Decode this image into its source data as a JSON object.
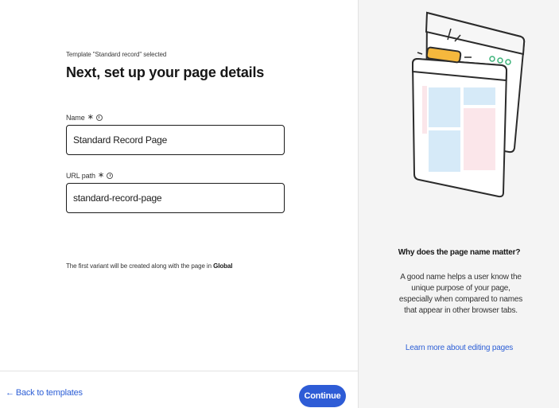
{
  "form": {
    "subtitle": "Template \"Standard record\" selected",
    "title": "Next, set up your page details",
    "name_label": "Name",
    "name_value": "Standard Record Page",
    "url_label": "URL path",
    "url_value": "standard-record-page",
    "required_mark": "∗",
    "note_prefix": "The first variant will be created along with the page in ",
    "note_bold": "Global"
  },
  "footer": {
    "back_arrow": "←",
    "back_label": "Back to templates",
    "continue_label": "Continue"
  },
  "info_panel": {
    "heading": "Why does the page name matter?",
    "body": "A good name helps a user know the unique purpose of your page, especially when compared to names that appear in other browser tabs.",
    "link": "Learn more about editing pages"
  },
  "colors": {
    "accent": "#2e5cd6",
    "link": "#2d5fd6",
    "panel_bg": "#f4f4f4",
    "highlight_tab": "#f5b83d",
    "illus_blue": "#d6eaf8",
    "illus_pink": "#fbe6ea"
  }
}
